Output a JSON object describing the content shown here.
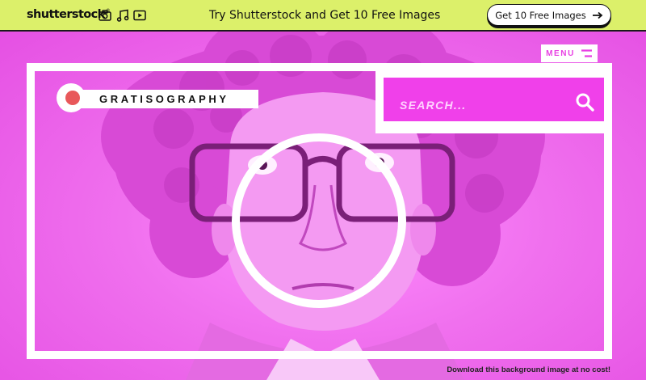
{
  "banner": {
    "brand": "shutterstock",
    "brand_mark": "®",
    "icons": [
      "camera-icon",
      "music-icon",
      "video-icon"
    ],
    "promo_text": "Try Shutterstock and Get 10 Free Images",
    "cta_label": "Get 10 Free Images",
    "cta_icon": "arrow-right-icon",
    "background_color": "#dcf06a"
  },
  "site": {
    "logo_text": "GRATISOGRAPHY",
    "logo_dot_color": "#e8585a",
    "menu_label": "MENU",
    "search_placeholder": "SEARCH...",
    "accent_color": "#f040ea",
    "credit_text": "Download this background image at no cost!"
  }
}
